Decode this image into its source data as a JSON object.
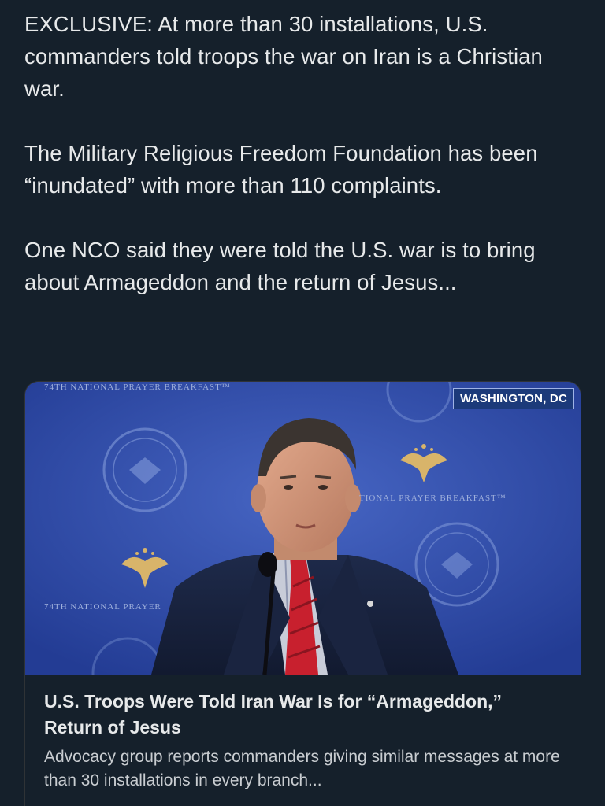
{
  "tweet": {
    "paragraphs": [
      "EXCLUSIVE: At more than 30 installations, U.S. commanders told troops the war on Iran is a Christian war.",
      "The Military Religious Freedom Foundation has been “inundated” with more than 110 complaints.",
      "One NCO said they were told the U.S. war is to bring about Armageddon and the return of Jesus..."
    ]
  },
  "card": {
    "image": {
      "location_badge": "WASHINGTON, DC",
      "banner_top_left": "74TH NATIONAL PRAYER BREAKFAST™",
      "banner_middle": "TIONAL PRAYER BREAKFAST™",
      "banner_lower_left": "74TH NATIONAL PRAYER"
    },
    "title": "U.S. Troops Were Told Iran War Is for “Armageddon,” Return of Jesus",
    "description": "Advocacy group reports commanders giving similar messages at more than 30 installations in every branch..."
  },
  "colors": {
    "background": "#15202b",
    "text": "#e7e9ea",
    "stage_blue": "#2e4aa8",
    "tie_red": "#c8202e",
    "eagle_gold": "#d8b46a"
  }
}
